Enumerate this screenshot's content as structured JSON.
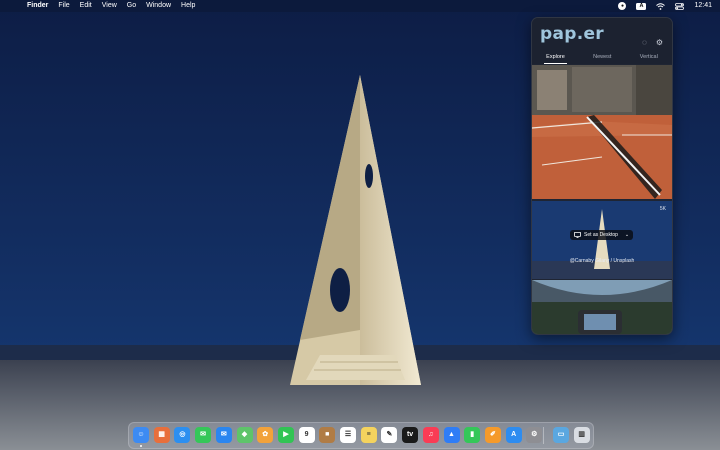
{
  "menubar": {
    "app_name": "Finder",
    "items": [
      "File",
      "Edit",
      "View",
      "Go",
      "Window",
      "Help"
    ],
    "input_source": "A",
    "clock": "12:41",
    "icons": [
      "apple-icon",
      "paper-status-icon",
      "input-source-icon",
      "wifi-icon",
      "control-center-icon"
    ]
  },
  "popover": {
    "logo": "pap.er",
    "tabs": [
      "Explore",
      "Newest",
      "Vertical"
    ],
    "active_tab": "Explore",
    "size_badge": "5K",
    "set_desktop_label": "Set as Desktop",
    "credit": "@Carnaby Gilany / Unsplash"
  },
  "dock": {
    "apps": [
      {
        "name": "Finder",
        "glyph": "☺",
        "color": "#3d8bf2"
      },
      {
        "name": "Launchpad",
        "glyph": "▦",
        "color": "#e86f3c"
      },
      {
        "name": "Safari",
        "glyph": "◎",
        "color": "#2c8ff0"
      },
      {
        "name": "Messages",
        "glyph": "✉",
        "color": "#35c759"
      },
      {
        "name": "Mail",
        "glyph": "✉",
        "color": "#2a86f0"
      },
      {
        "name": "Maps",
        "glyph": "◆",
        "color": "#5ec46a"
      },
      {
        "name": "Photos",
        "glyph": "✿",
        "color": "#f2a23a"
      },
      {
        "name": "FaceTime",
        "glyph": "▶",
        "color": "#31c454"
      },
      {
        "name": "Calendar",
        "glyph": "9",
        "color": "#ffffff"
      },
      {
        "name": "Notes Brown",
        "glyph": "■",
        "color": "#b07c45"
      },
      {
        "name": "Reminders",
        "glyph": "☰",
        "color": "#ffffff"
      },
      {
        "name": "Notes",
        "glyph": "≡",
        "color": "#f4d35e"
      },
      {
        "name": "Freeform",
        "glyph": "✎",
        "color": "#ffffff"
      },
      {
        "name": "TV",
        "glyph": "tv",
        "color": "#1a1a1a"
      },
      {
        "name": "Music",
        "glyph": "♫",
        "color": "#fa3c55"
      },
      {
        "name": "Keynote",
        "glyph": "▲",
        "color": "#2f7df6"
      },
      {
        "name": "Numbers",
        "glyph": "▮",
        "color": "#34c759"
      },
      {
        "name": "Pages",
        "glyph": "✐",
        "color": "#f59a2a"
      },
      {
        "name": "App Store",
        "glyph": "A",
        "color": "#2d8cf0"
      },
      {
        "name": "System Settings",
        "glyph": "⚙",
        "color": "#8e8e93"
      },
      {
        "name": "Downloads",
        "glyph": "▭",
        "color": "#5aa7e0"
      },
      {
        "name": "Trash",
        "glyph": "▥",
        "color": "#d9dde3"
      }
    ]
  }
}
